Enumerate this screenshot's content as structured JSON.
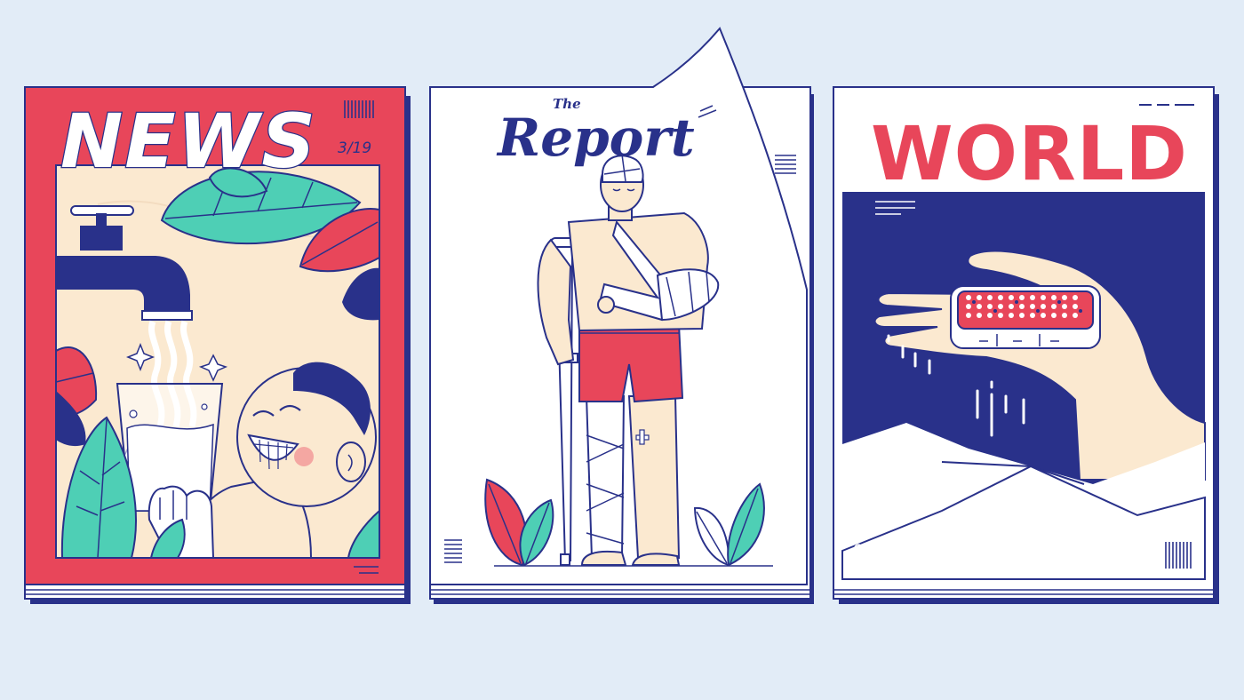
{
  "covers": {
    "news": {
      "title": "NEWS",
      "issue": "3/19"
    },
    "report": {
      "the": "The",
      "title": "Report"
    },
    "world": {
      "title": "WORLD"
    }
  },
  "colors": {
    "background": "#e2ecf7",
    "navy": "#29318a",
    "red": "#e8465a",
    "cream": "#fbe9d0",
    "teal": "#4ecfb5",
    "white": "#ffffff"
  }
}
